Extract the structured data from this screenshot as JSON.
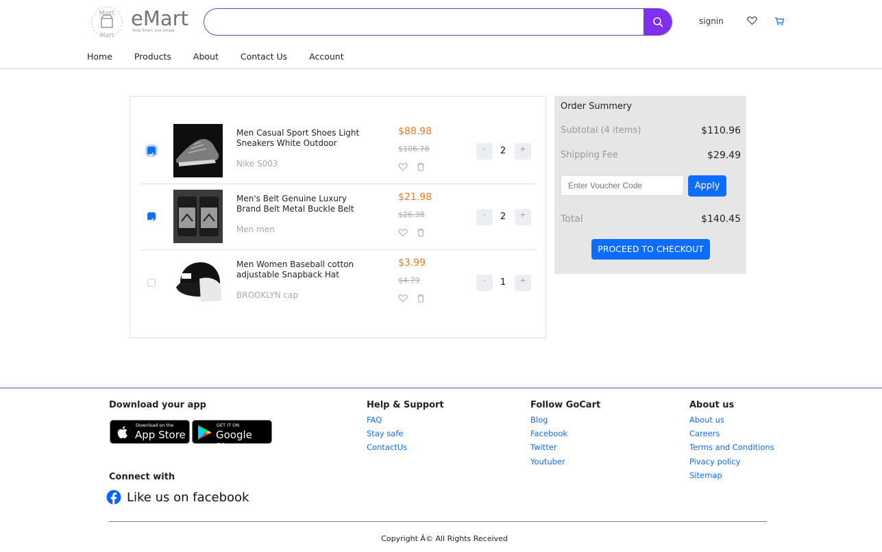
{
  "brand": {
    "name": "eMart",
    "tagline": "Shop Smart, Live Simple"
  },
  "search": {
    "value": "",
    "placeholder": ""
  },
  "header": {
    "signin_label": "signin"
  },
  "nav": {
    "items": [
      "Home",
      "Products",
      "About",
      "Contact Us",
      "Account"
    ]
  },
  "cart": {
    "items": [
      {
        "title": "Men Casual Sport Shoes Light Sneakers White Outdoor",
        "brand": "Nike S003",
        "price": "$88.98",
        "old_price": "$106.78",
        "qty": "2",
        "minus": "-",
        "plus": "+",
        "checked": true
      },
      {
        "title": "Men's Belt Genuine Luxury Brand Belt Metal Buckle Belt",
        "brand": "Men men",
        "price": "$21.98",
        "old_price": "$26.38",
        "qty": "2",
        "minus": "-",
        "plus": "+",
        "checked": true
      },
      {
        "title": "Men Women Baseball cotton adjustable Snapback Hat",
        "brand": "BROOKLYN cap",
        "price": "$3.99",
        "old_price": "$4.79",
        "qty": "1",
        "minus": "-",
        "plus": "+",
        "checked": false
      }
    ]
  },
  "summary": {
    "title": "Order Summery",
    "subtotal_label": "Subtotal (4 items)",
    "subtotal_value": "$110.96",
    "shipping_label": "Shipping Fee",
    "shipping_value": "$29.49",
    "voucher_placeholder": "Enter Voucher Code",
    "apply_label": "Apply",
    "total_label": "Total",
    "total_value": "$140.45",
    "checkout_label": "PROCEED TO CHECKOUT"
  },
  "footer": {
    "download_heading": "Download your app",
    "appstore_small": "Download on the",
    "appstore_big": "App Store",
    "googleplay_small": "GET IT ON",
    "googleplay_big": "Google Play",
    "connect_heading": "Connect with",
    "facebook_text": "Like us on facebook",
    "columns": [
      {
        "heading": "Help & Support",
        "links": [
          "FAQ",
          "Stay safe",
          "ContactUs"
        ]
      },
      {
        "heading": "Follow GoCart",
        "links": [
          "Blog",
          "Facebook",
          "Twitter",
          "Youtuber"
        ]
      },
      {
        "heading": "About us",
        "links": [
          "About us",
          "Careers",
          "Terms and Conditions",
          "Pivacy policy",
          "Sitemap"
        ]
      }
    ],
    "copyright": "Copyright Â© All Rights Received"
  },
  "colors": {
    "accent": "#7e2ff0",
    "primary": "#0d6efd",
    "price": "#f27a1a"
  }
}
